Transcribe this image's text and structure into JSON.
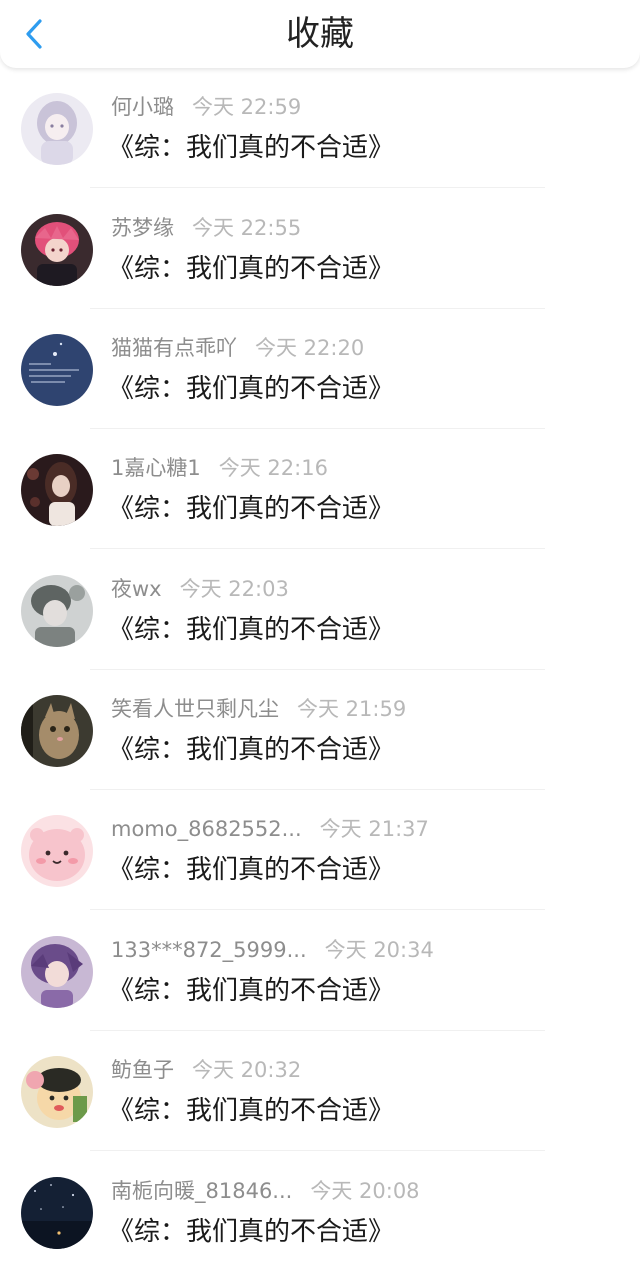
{
  "header": {
    "title": "收藏",
    "back_icon": "chevron-left-icon",
    "accent_color": "#2e9cef"
  },
  "items": [
    {
      "username": "何小璐",
      "time": "今天 22:59",
      "content": "《综：我们真的不合适》"
    },
    {
      "username": "苏梦缘",
      "time": "今天 22:55",
      "content": "《综：我们真的不合适》"
    },
    {
      "username": "猫猫有点乖吖",
      "time": "今天 22:20",
      "content": "《综：我们真的不合适》"
    },
    {
      "username": "1嘉心糖1",
      "time": "今天 22:16",
      "content": "《综：我们真的不合适》"
    },
    {
      "username": "夜wx",
      "time": "今天 22:03",
      "content": "《综：我们真的不合适》"
    },
    {
      "username": "笑看人世只剩凡尘",
      "time": "今天 21:59",
      "content": "《综：我们真的不合适》"
    },
    {
      "username": "momo_8682552...",
      "time": "今天 21:37",
      "content": "《综：我们真的不合适》"
    },
    {
      "username": "133***872_5999...",
      "time": "今天 20:34",
      "content": "《综：我们真的不合适》"
    },
    {
      "username": "鲂鱼子",
      "time": "今天 20:32",
      "content": "《综：我们真的不合适》"
    },
    {
      "username": "南栀向暖_81846...",
      "time": "今天 20:08",
      "content": "《综：我们真的不合适》"
    }
  ]
}
